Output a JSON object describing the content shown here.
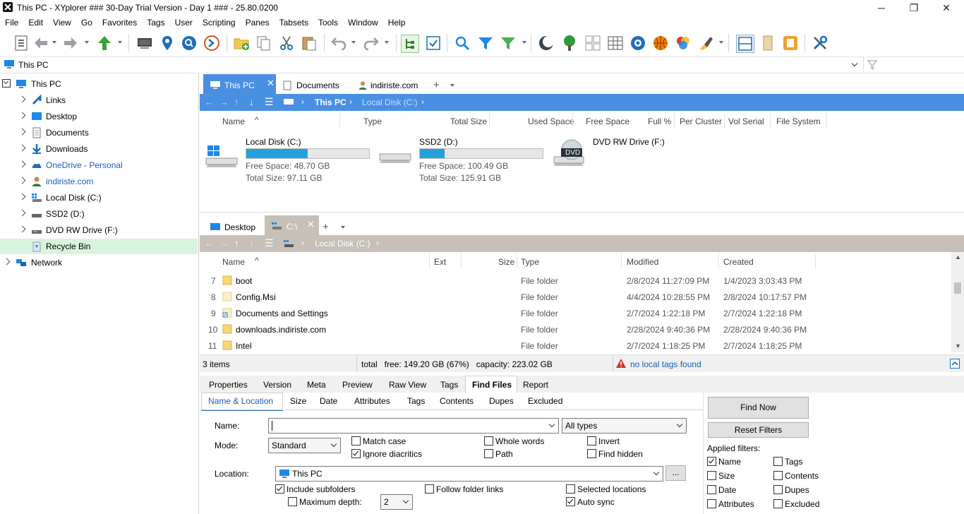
{
  "window": {
    "title": "This PC - XYplorer ### 30-Day Trial Version - Day 1 ### - 25.80.0200",
    "minimize": "─",
    "restore": "❐",
    "close": "✕"
  },
  "menu": [
    "File",
    "Edit",
    "View",
    "Go",
    "Favorites",
    "Tags",
    "User",
    "Scripting",
    "Panes",
    "Tabsets",
    "Tools",
    "Window",
    "Help"
  ],
  "address": {
    "path": "This PC"
  },
  "tree": [
    {
      "label": "This PC"
    },
    {
      "label": "Links"
    },
    {
      "label": "Desktop"
    },
    {
      "label": "Documents"
    },
    {
      "label": "Downloads"
    },
    {
      "label": "OneDrive - Personal"
    },
    {
      "label": "indiriste.com"
    },
    {
      "label": "Local Disk (C:)"
    },
    {
      "label": "SSD2 (D:)"
    },
    {
      "label": "DVD RW Drive (F:)"
    },
    {
      "label": "Recycle Bin"
    },
    {
      "label": "Network"
    }
  ],
  "pane1": {
    "tabs": [
      {
        "label": "This PC"
      },
      {
        "label": "Documents"
      },
      {
        "label": "indiriste.com"
      }
    ],
    "add_tab": "+",
    "crumbs": [
      "This PC",
      "Local Disk (C:)"
    ],
    "columns": [
      "Name",
      "Type",
      "Total Size",
      "Used Space",
      "Free Space",
      "Full %",
      "Per Cluster",
      "Vol Serial",
      "File System"
    ],
    "drives": [
      {
        "name": "Local Disk (C:)",
        "free": "Free Space: 48.70 GB",
        "total": "Total Size: 97.11 GB",
        "used_pct": 50
      },
      {
        "name": "SSD2 (D:)",
        "free": "Free Space: 100.49 GB",
        "total": "Total Size: 125.91 GB",
        "used_pct": 20
      },
      {
        "name": "DVD RW Drive (F:)",
        "badge": "DVD"
      }
    ]
  },
  "pane2": {
    "tabs": [
      {
        "label": "Desktop"
      },
      {
        "label": "C:\\"
      }
    ],
    "add_tab": "+",
    "crumbs": [
      "Local Disk (C:)"
    ],
    "columns": [
      "Name",
      "Ext",
      "Size",
      "Type",
      "Modified",
      "Created"
    ],
    "rows": [
      {
        "num": "7",
        "name": "boot",
        "type": "File folder",
        "modified": "2/8/2024 11:27:09 PM",
        "created": "1/4/2023 3:03:43 PM"
      },
      {
        "num": "8",
        "name": "Config.Msi",
        "type": "File folder",
        "modified": "4/4/2024 10:28:55 PM",
        "created": "2/8/2024 10:17:57 PM"
      },
      {
        "num": "9",
        "name": "Documents and Settings",
        "type": "File folder",
        "modified": "2/7/2024 1:22:18 PM",
        "created": "2/7/2024 1:22:18 PM"
      },
      {
        "num": "10",
        "name": "downloads.indiriste.com",
        "type": "File folder",
        "modified": "2/28/2024 9:40:36 PM",
        "created": "2/28/2024 9:40:36 PM"
      },
      {
        "num": "11",
        "name": "Intel",
        "type": "File folder",
        "modified": "2/7/2024 1:18:25 PM",
        "created": "2/7/2024 1:18:25 PM"
      }
    ]
  },
  "status": {
    "items": "3 items",
    "total": "total   free: 149.20 GB (67%)   capacity: 223.02 GB",
    "tags": "no local tags found"
  },
  "info_tabs": [
    "Properties",
    "Version",
    "Meta",
    "Preview",
    "Raw View",
    "Tags",
    "Find Files",
    "Report"
  ],
  "find_tabs": [
    "Name & Location",
    "Size",
    "Date",
    "Attributes",
    "Tags",
    "Contents",
    "Dupes",
    "Excluded"
  ],
  "find": {
    "name_label": "Name:",
    "name_value": "",
    "type_value": "All types",
    "mode_label": "Mode:",
    "mode_value": "Standard",
    "match_case": "Match case",
    "ignore_diacritics": "Ignore diacritics",
    "whole_words": "Whole words",
    "path": "Path",
    "invert": "Invert",
    "find_hidden": "Find hidden",
    "location_label": "Location:",
    "location_value": "This PC",
    "browse": "...",
    "include_subfolders": "Include subfolders",
    "follow_links": "Follow folder links",
    "selected_locations": "Selected locations",
    "max_depth": "Maximum depth:",
    "max_depth_value": "2",
    "auto_sync": "Auto sync",
    "find_now": "Find Now",
    "reset_filters": "Reset Filters",
    "applied_filters": "Applied filters:",
    "filters": [
      "Name",
      "Tags",
      "Size",
      "Contents",
      "Date",
      "Dupes",
      "Attributes",
      "Excluded"
    ]
  },
  "colors": {
    "accent": "#4a90e2",
    "tab_active": "#6aa6e8",
    "pane2_bar": "#c6c0b8",
    "selection": "#d9f4dc"
  }
}
